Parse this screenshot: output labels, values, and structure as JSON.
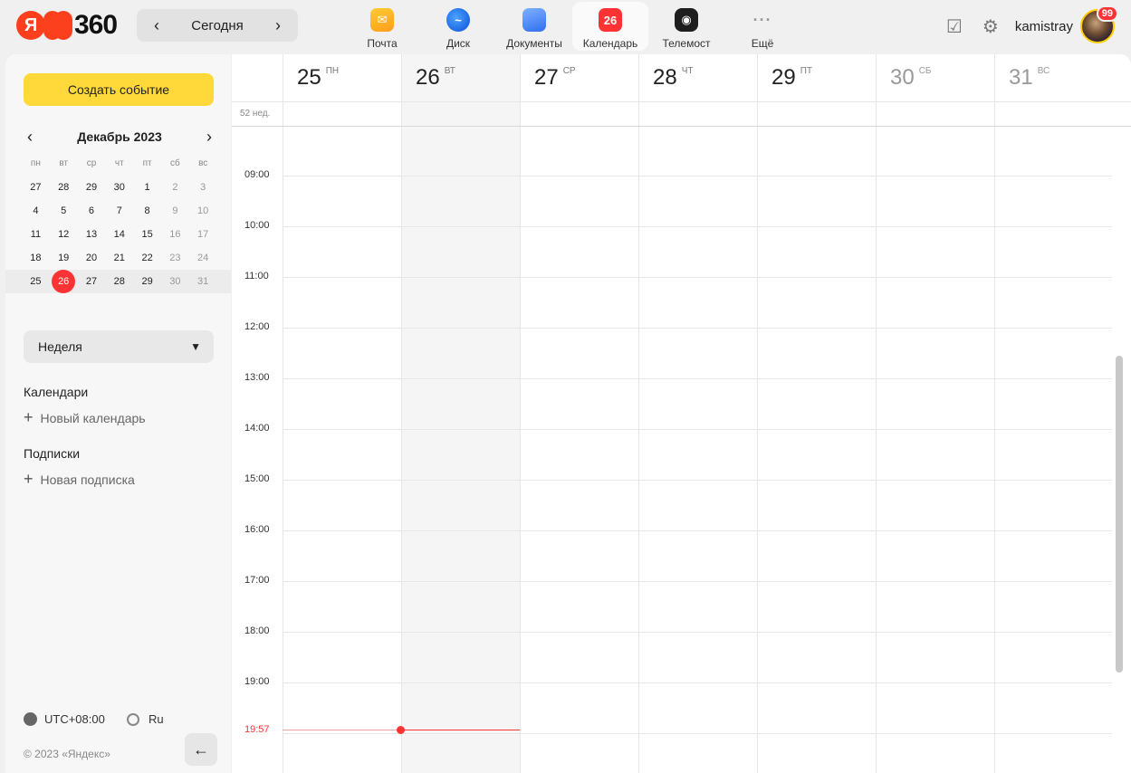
{
  "header": {
    "logo_text": "360",
    "today_label": "Сегодня",
    "apps": [
      {
        "label": "Почта",
        "icon": "mail-icon"
      },
      {
        "label": "Диск",
        "icon": "disk-icon"
      },
      {
        "label": "Документы",
        "icon": "docs-icon"
      },
      {
        "label": "Календарь",
        "icon": "calendar-icon",
        "badge": "26"
      },
      {
        "label": "Телемост",
        "icon": "telemost-icon"
      },
      {
        "label": "Ещё",
        "icon": "more-icon",
        "glyph": "···"
      }
    ],
    "username": "kamistray",
    "avatar_badge": "99"
  },
  "sidebar": {
    "create_label": "Создать событие",
    "mini_calendar": {
      "month_label": "Декабрь 2023",
      "weekdays": [
        "пн",
        "вт",
        "ср",
        "чт",
        "пт",
        "сб",
        "вс"
      ],
      "weeks": [
        [
          "27",
          "28",
          "29",
          "30",
          "1",
          "2",
          "3"
        ],
        [
          "4",
          "5",
          "6",
          "7",
          "8",
          "9",
          "10"
        ],
        [
          "11",
          "12",
          "13",
          "14",
          "15",
          "16",
          "17"
        ],
        [
          "18",
          "19",
          "20",
          "21",
          "22",
          "23",
          "24"
        ],
        [
          "25",
          "26",
          "27",
          "28",
          "29",
          "30",
          "31"
        ]
      ],
      "today": "26"
    },
    "view_label": "Неделя",
    "calendars_title": "Календари",
    "new_calendar_label": "Новый календарь",
    "subscriptions_title": "Подписки",
    "new_subscription_label": "Новая подписка",
    "timezone": "UTC+08:00",
    "language": "Ru",
    "copyright": "© 2023 «Яндекс»"
  },
  "week": {
    "week_label": "52 нед.",
    "days": [
      {
        "num": "25",
        "name": "пн"
      },
      {
        "num": "26",
        "name": "вт"
      },
      {
        "num": "27",
        "name": "ср"
      },
      {
        "num": "28",
        "name": "чт"
      },
      {
        "num": "29",
        "name": "пт"
      },
      {
        "num": "30",
        "name": "сб"
      },
      {
        "num": "31",
        "name": "вс"
      }
    ],
    "hours": [
      "09:00",
      "10:00",
      "11:00",
      "12:00",
      "13:00",
      "14:00",
      "15:00",
      "16:00",
      "17:00",
      "18:00",
      "19:00"
    ],
    "now_time": "19:57"
  },
  "colors": {
    "accent_yellow": "#ffd83a",
    "today_red": "#ff3333"
  }
}
